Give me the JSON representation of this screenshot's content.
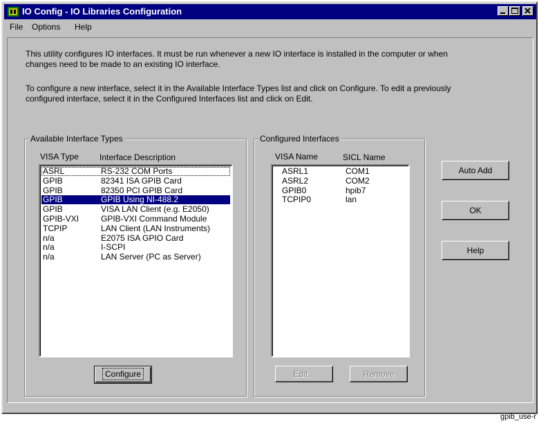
{
  "window": {
    "title": "IO Config - IO Libraries Configuration"
  },
  "menubar": {
    "items": [
      {
        "label": "File"
      },
      {
        "label": "Options"
      },
      {
        "label": "Help"
      }
    ]
  },
  "intro": {
    "line1": "This utility configures IO interfaces.  It must be run whenever a new IO interface is installed in the computer or when",
    "line2": "changes need to be made to an existing IO interface.",
    "line3": "To configure a new interface, select it in the Available Interface Types list and click on Configure.  To edit a previously",
    "line4": "configured interface, select it in the Configured Interfaces list and click on Edit."
  },
  "available": {
    "group_label": "Available Interface Types",
    "col_type": "VISA Type",
    "col_desc": "Interface Description",
    "selected_index": 3,
    "rows": [
      {
        "type": "ASRL",
        "desc": "RS-232 COM Ports"
      },
      {
        "type": "GPIB",
        "desc": "82341 ISA GPIB Card"
      },
      {
        "type": "GPIB",
        "desc": "82350 PCI GPIB Card"
      },
      {
        "type": "GPIB",
        "desc": "GPIB Using NI-488.2"
      },
      {
        "type": "GPIB",
        "desc": "VISA LAN Client (e.g. E2050)"
      },
      {
        "type": "GPIB-VXI",
        "desc": "GPIB-VXI Command Module"
      },
      {
        "type": "TCPIP",
        "desc": "LAN Client (LAN Instruments)"
      },
      {
        "type": "n/a",
        "desc": "E2075 ISA GPIO Card"
      },
      {
        "type": "n/a",
        "desc": "I-SCPI"
      },
      {
        "type": "n/a",
        "desc": "LAN Server (PC as Server)"
      }
    ],
    "configure_label": "Configure"
  },
  "configured": {
    "group_label": "Configured Interfaces",
    "col_name": "VISA Name",
    "col_sicl": "SICL Name",
    "rows": [
      {
        "name": "ASRL1",
        "sicl": "COM1"
      },
      {
        "name": "ASRL2",
        "sicl": "COM2"
      },
      {
        "name": "GPIB0",
        "sicl": "hpib7"
      },
      {
        "name": "TCPIP0",
        "sicl": "lan"
      }
    ],
    "edit_label": "Edit...",
    "remove_label": "Remove"
  },
  "side_buttons": {
    "auto_add": "Auto Add",
    "ok": "OK",
    "help": "Help"
  },
  "caption": "gpib_use-r",
  "colors": {
    "titlebar": "#000080",
    "face": "#c0c0c0",
    "selection": "#000080"
  }
}
